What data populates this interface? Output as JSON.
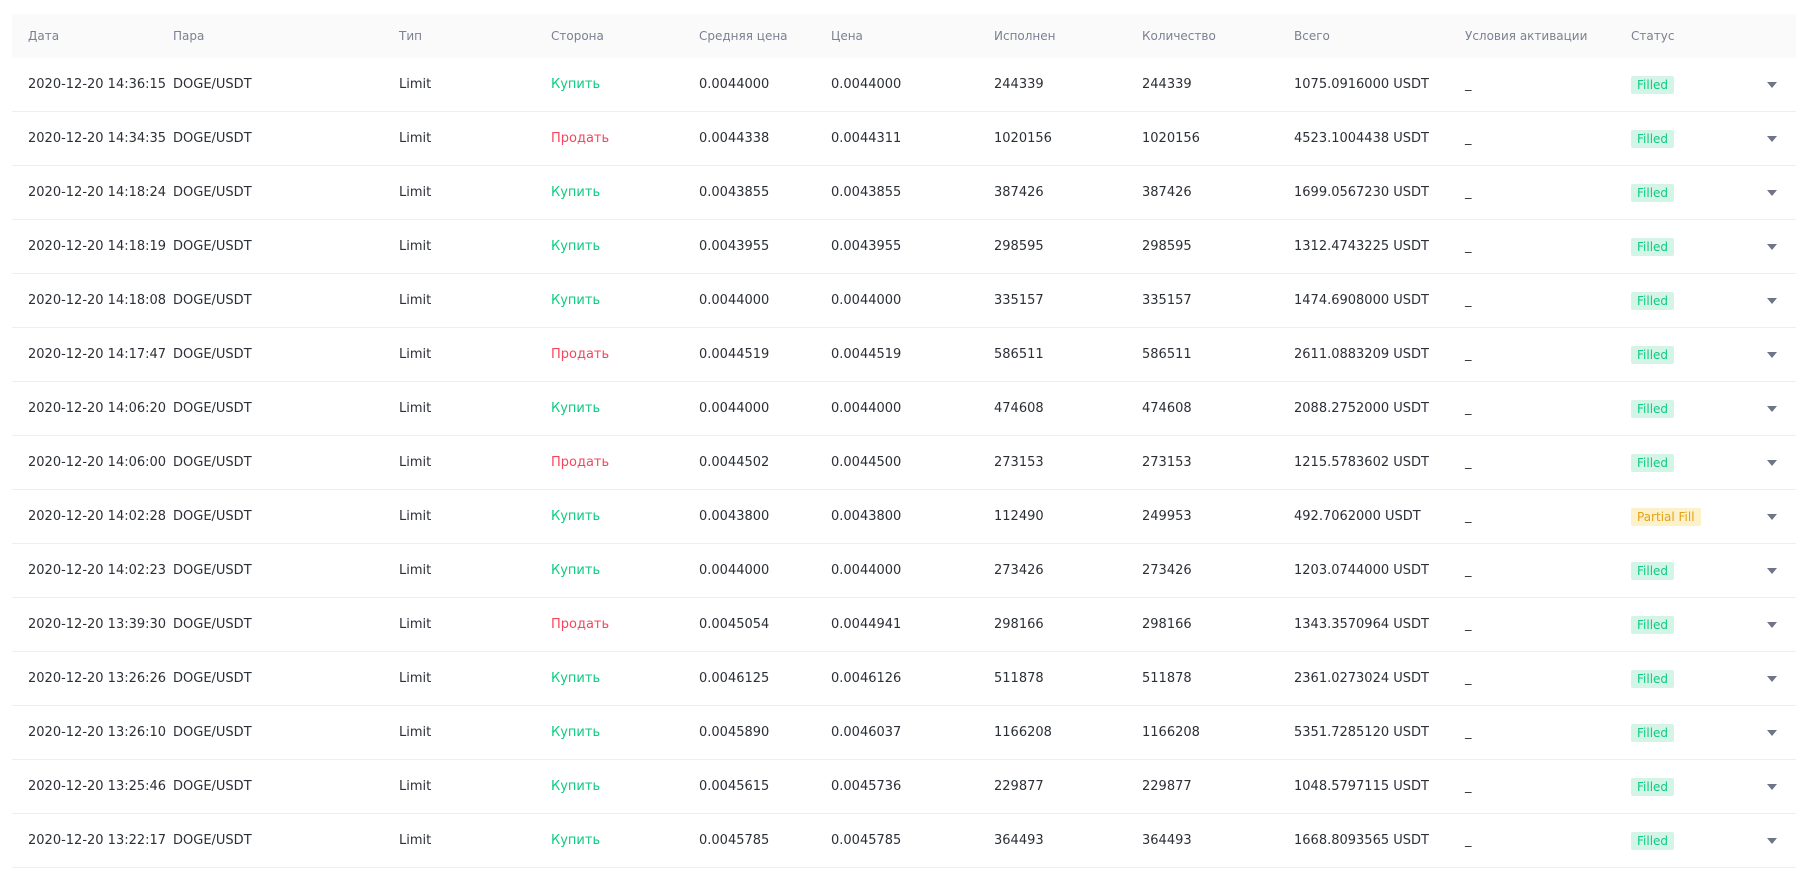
{
  "columns": {
    "date": "Дата",
    "pair": "Пара",
    "type": "Тип",
    "side": "Сторона",
    "avg_price": "Средняя цена",
    "price": "Цена",
    "filled": "Исполнен",
    "quantity": "Количество",
    "total": "Всего",
    "conditions": "Условия активации",
    "status": "Статус"
  },
  "colors": {
    "buy": "#0ecb81",
    "sell": "#f6465d",
    "filled_badge_bg": "#d4f4e7",
    "partial_badge_bg": "#fdf1c9",
    "partial_badge_text": "#e3a21a"
  },
  "icons": {
    "expand": "chevron-down-icon"
  },
  "orders": [
    {
      "date": "2020-12-20 14:36:15",
      "pair": "DOGE/USDT",
      "type": "Limit",
      "side": "Купить",
      "side_kind": "buy",
      "avg_price": "0.0044000",
      "price": "0.0044000",
      "filled": "244339",
      "quantity": "244339",
      "total": "1075.0916000 USDT",
      "conditions": "_",
      "status": "Filled",
      "status_kind": "filled"
    },
    {
      "date": "2020-12-20 14:34:35",
      "pair": "DOGE/USDT",
      "type": "Limit",
      "side": "Продать",
      "side_kind": "sell",
      "avg_price": "0.0044338",
      "price": "0.0044311",
      "filled": "1020156",
      "quantity": "1020156",
      "total": "4523.1004438 USDT",
      "conditions": "_",
      "status": "Filled",
      "status_kind": "filled"
    },
    {
      "date": "2020-12-20 14:18:24",
      "pair": "DOGE/USDT",
      "type": "Limit",
      "side": "Купить",
      "side_kind": "buy",
      "avg_price": "0.0043855",
      "price": "0.0043855",
      "filled": "387426",
      "quantity": "387426",
      "total": "1699.0567230 USDT",
      "conditions": "_",
      "status": "Filled",
      "status_kind": "filled"
    },
    {
      "date": "2020-12-20 14:18:19",
      "pair": "DOGE/USDT",
      "type": "Limit",
      "side": "Купить",
      "side_kind": "buy",
      "avg_price": "0.0043955",
      "price": "0.0043955",
      "filled": "298595",
      "quantity": "298595",
      "total": "1312.4743225 USDT",
      "conditions": "_",
      "status": "Filled",
      "status_kind": "filled"
    },
    {
      "date": "2020-12-20 14:18:08",
      "pair": "DOGE/USDT",
      "type": "Limit",
      "side": "Купить",
      "side_kind": "buy",
      "avg_price": "0.0044000",
      "price": "0.0044000",
      "filled": "335157",
      "quantity": "335157",
      "total": "1474.6908000 USDT",
      "conditions": "_",
      "status": "Filled",
      "status_kind": "filled"
    },
    {
      "date": "2020-12-20 14:17:47",
      "pair": "DOGE/USDT",
      "type": "Limit",
      "side": "Продать",
      "side_kind": "sell",
      "avg_price": "0.0044519",
      "price": "0.0044519",
      "filled": "586511",
      "quantity": "586511",
      "total": "2611.0883209 USDT",
      "conditions": "_",
      "status": "Filled",
      "status_kind": "filled"
    },
    {
      "date": "2020-12-20 14:06:20",
      "pair": "DOGE/USDT",
      "type": "Limit",
      "side": "Купить",
      "side_kind": "buy",
      "avg_price": "0.0044000",
      "price": "0.0044000",
      "filled": "474608",
      "quantity": "474608",
      "total": "2088.2752000 USDT",
      "conditions": "_",
      "status": "Filled",
      "status_kind": "filled"
    },
    {
      "date": "2020-12-20 14:06:00",
      "pair": "DOGE/USDT",
      "type": "Limit",
      "side": "Продать",
      "side_kind": "sell",
      "avg_price": "0.0044502",
      "price": "0.0044500",
      "filled": "273153",
      "quantity": "273153",
      "total": "1215.5783602 USDT",
      "conditions": "_",
      "status": "Filled",
      "status_kind": "filled"
    },
    {
      "date": "2020-12-20 14:02:28",
      "pair": "DOGE/USDT",
      "type": "Limit",
      "side": "Купить",
      "side_kind": "buy",
      "avg_price": "0.0043800",
      "price": "0.0043800",
      "filled": "112490",
      "quantity": "249953",
      "total": "492.7062000 USDT",
      "conditions": "_",
      "status": "Partial Fill",
      "status_kind": "partial"
    },
    {
      "date": "2020-12-20 14:02:23",
      "pair": "DOGE/USDT",
      "type": "Limit",
      "side": "Купить",
      "side_kind": "buy",
      "avg_price": "0.0044000",
      "price": "0.0044000",
      "filled": "273426",
      "quantity": "273426",
      "total": "1203.0744000 USDT",
      "conditions": "_",
      "status": "Filled",
      "status_kind": "filled"
    },
    {
      "date": "2020-12-20 13:39:30",
      "pair": "DOGE/USDT",
      "type": "Limit",
      "side": "Продать",
      "side_kind": "sell",
      "avg_price": "0.0045054",
      "price": "0.0044941",
      "filled": "298166",
      "quantity": "298166",
      "total": "1343.3570964 USDT",
      "conditions": "_",
      "status": "Filled",
      "status_kind": "filled"
    },
    {
      "date": "2020-12-20 13:26:26",
      "pair": "DOGE/USDT",
      "type": "Limit",
      "side": "Купить",
      "side_kind": "buy",
      "avg_price": "0.0046125",
      "price": "0.0046126",
      "filled": "511878",
      "quantity": "511878",
      "total": "2361.0273024 USDT",
      "conditions": "_",
      "status": "Filled",
      "status_kind": "filled"
    },
    {
      "date": "2020-12-20 13:26:10",
      "pair": "DOGE/USDT",
      "type": "Limit",
      "side": "Купить",
      "side_kind": "buy",
      "avg_price": "0.0045890",
      "price": "0.0046037",
      "filled": "1166208",
      "quantity": "1166208",
      "total": "5351.7285120 USDT",
      "conditions": "_",
      "status": "Filled",
      "status_kind": "filled"
    },
    {
      "date": "2020-12-20 13:25:46",
      "pair": "DOGE/USDT",
      "type": "Limit",
      "side": "Купить",
      "side_kind": "buy",
      "avg_price": "0.0045615",
      "price": "0.0045736",
      "filled": "229877",
      "quantity": "229877",
      "total": "1048.5797115 USDT",
      "conditions": "_",
      "status": "Filled",
      "status_kind": "filled"
    },
    {
      "date": "2020-12-20 13:22:17",
      "pair": "DOGE/USDT",
      "type": "Limit",
      "side": "Купить",
      "side_kind": "buy",
      "avg_price": "0.0045785",
      "price": "0.0045785",
      "filled": "364493",
      "quantity": "364493",
      "total": "1668.8093565 USDT",
      "conditions": "_",
      "status": "Filled",
      "status_kind": "filled"
    }
  ]
}
